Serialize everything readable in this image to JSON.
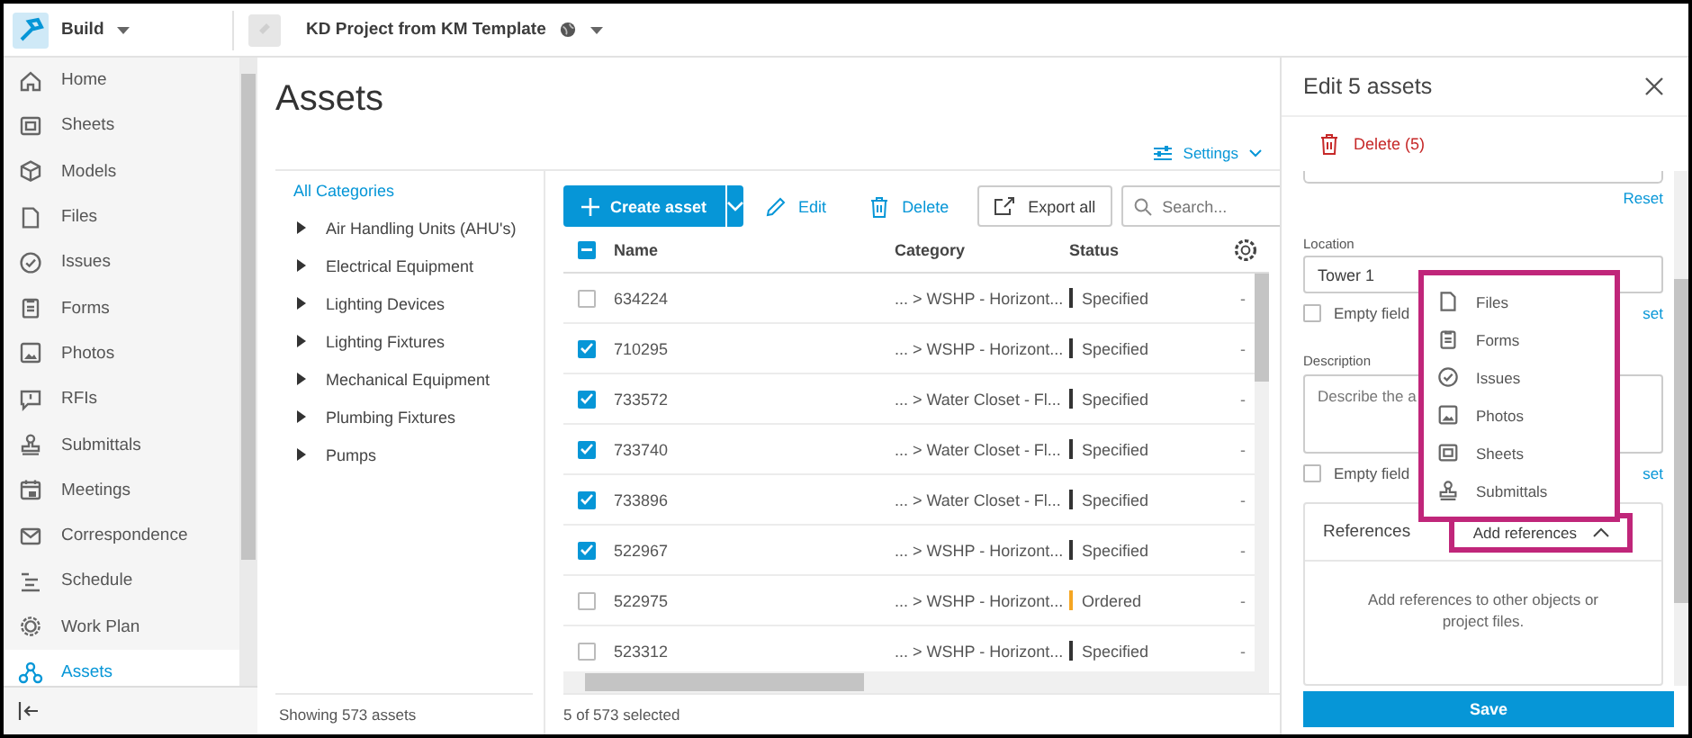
{
  "topbar": {
    "app": "Build",
    "project": "KD Project from KM Template"
  },
  "sidebar": {
    "items": [
      {
        "label": "Home",
        "selected": false
      },
      {
        "label": "Sheets",
        "selected": false
      },
      {
        "label": "Models",
        "selected": false
      },
      {
        "label": "Files",
        "selected": false
      },
      {
        "label": "Issues",
        "selected": false
      },
      {
        "label": "Forms",
        "selected": false
      },
      {
        "label": "Photos",
        "selected": false
      },
      {
        "label": "RFIs",
        "selected": false
      },
      {
        "label": "Submittals",
        "selected": false
      },
      {
        "label": "Meetings",
        "selected": false
      },
      {
        "label": "Correspondence",
        "selected": false
      },
      {
        "label": "Schedule",
        "selected": false
      },
      {
        "label": "Work Plan",
        "selected": false
      },
      {
        "label": "Assets",
        "selected": true
      }
    ]
  },
  "page": {
    "title": "Assets",
    "settings": "Settings"
  },
  "categories": {
    "all": "All Categories",
    "items": [
      "Air Handling Units (AHU's)",
      "Electrical Equipment",
      "Lighting Devices",
      "Lighting Fixtures",
      "Mechanical Equipment",
      "Plumbing Fixtures",
      "Pumps"
    ],
    "footer": "Showing 573 assets"
  },
  "toolbar": {
    "create": "Create asset",
    "edit": "Edit",
    "delete": "Delete",
    "export": "Export all",
    "search_placeholder": "Search..."
  },
  "table": {
    "header_indeterminate": true,
    "columns": [
      "Name",
      "Category",
      "Status"
    ],
    "rows": [
      {
        "name": "634224",
        "category": "... > WSHP - Horizont...",
        "status": "Specified",
        "color": "#333333",
        "column_4": "-",
        "checked": false
      },
      {
        "name": "710295",
        "category": "... > WSHP - Horizont...",
        "status": "Specified",
        "color": "#333333",
        "column_4": "-",
        "checked": true
      },
      {
        "name": "733572",
        "category": "... > Water Closet - Fl...",
        "status": "Specified",
        "color": "#333333",
        "column_4": "-",
        "checked": true
      },
      {
        "name": "733740",
        "category": "... > Water Closet - Fl...",
        "status": "Specified",
        "color": "#333333",
        "column_4": "-",
        "checked": true
      },
      {
        "name": "733896",
        "category": "... > Water Closet - Fl...",
        "status": "Specified",
        "color": "#333333",
        "column_4": "-",
        "checked": true
      },
      {
        "name": "522967",
        "category": "... > WSHP - Horizont...",
        "status": "Specified",
        "color": "#333333",
        "column_4": "-",
        "checked": true
      },
      {
        "name": "522975",
        "category": "... > WSHP - Horizont...",
        "status": "Ordered",
        "color": "#f5a623",
        "column_4": "-",
        "checked": false
      },
      {
        "name": "523312",
        "category": "... > WSHP - Horizont...",
        "status": "Specified",
        "color": "#333333",
        "column_4": "-",
        "checked": false
      }
    ],
    "footer": "5 of 573 selected"
  },
  "panel": {
    "title": "Edit 5 assets",
    "delete": "Delete (5)",
    "reset": "Reset",
    "location_label": "Location",
    "location_value": "Tower 1",
    "empty_1": {
      "label": "Empty field",
      "checked": false,
      "reset": "set"
    },
    "description_label": "Description",
    "description_placeholder": "Describe the a",
    "empty_2": {
      "label": "Empty field",
      "checked": false,
      "reset": "set"
    },
    "references": {
      "title": "References",
      "add": "Add references",
      "expanded": true,
      "body": "Add references to other objects or project files."
    },
    "save": "Save"
  },
  "dropdown": {
    "items": [
      "Files",
      "Forms",
      "Issues",
      "Photos",
      "Sheets",
      "Submittals"
    ]
  }
}
